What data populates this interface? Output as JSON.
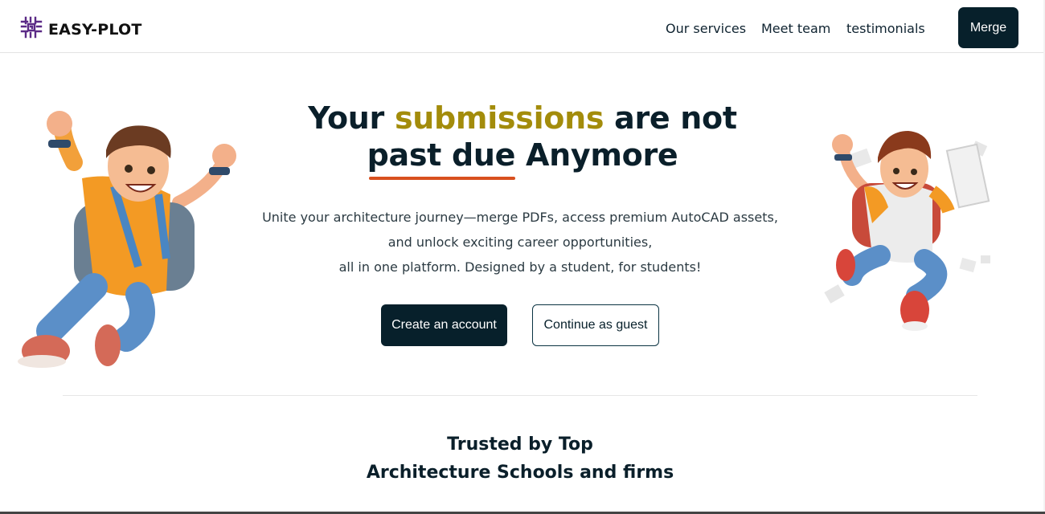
{
  "header": {
    "brand": "EASY-PLOT",
    "nav": [
      "Our services",
      "Meet team",
      "testimonials"
    ],
    "merge_label": "Merge"
  },
  "hero": {
    "title_part1": "Your",
    "title_highlight": "submissions",
    "title_part2": "are not",
    "title_underlined": "past due",
    "title_part3": "Anymore",
    "subtitle_lines": [
      "Unite your architecture journey—merge PDFs, access premium AutoCAD assets,",
      "and unlock exciting career opportunities,",
      "all in one platform. Designed by a student, for students!"
    ],
    "primary_cta": "Create an account",
    "secondary_cta": "Continue as guest"
  },
  "trusted": {
    "line1": "Trusted by Top",
    "line2": "Architecture Schools and firms"
  },
  "colors": {
    "brand_dark": "#07202b",
    "highlight": "#a38c0b",
    "underline": "#d8501f",
    "logo_purple": "#5b2a86"
  },
  "icons": [
    "logo-maze-icon"
  ]
}
